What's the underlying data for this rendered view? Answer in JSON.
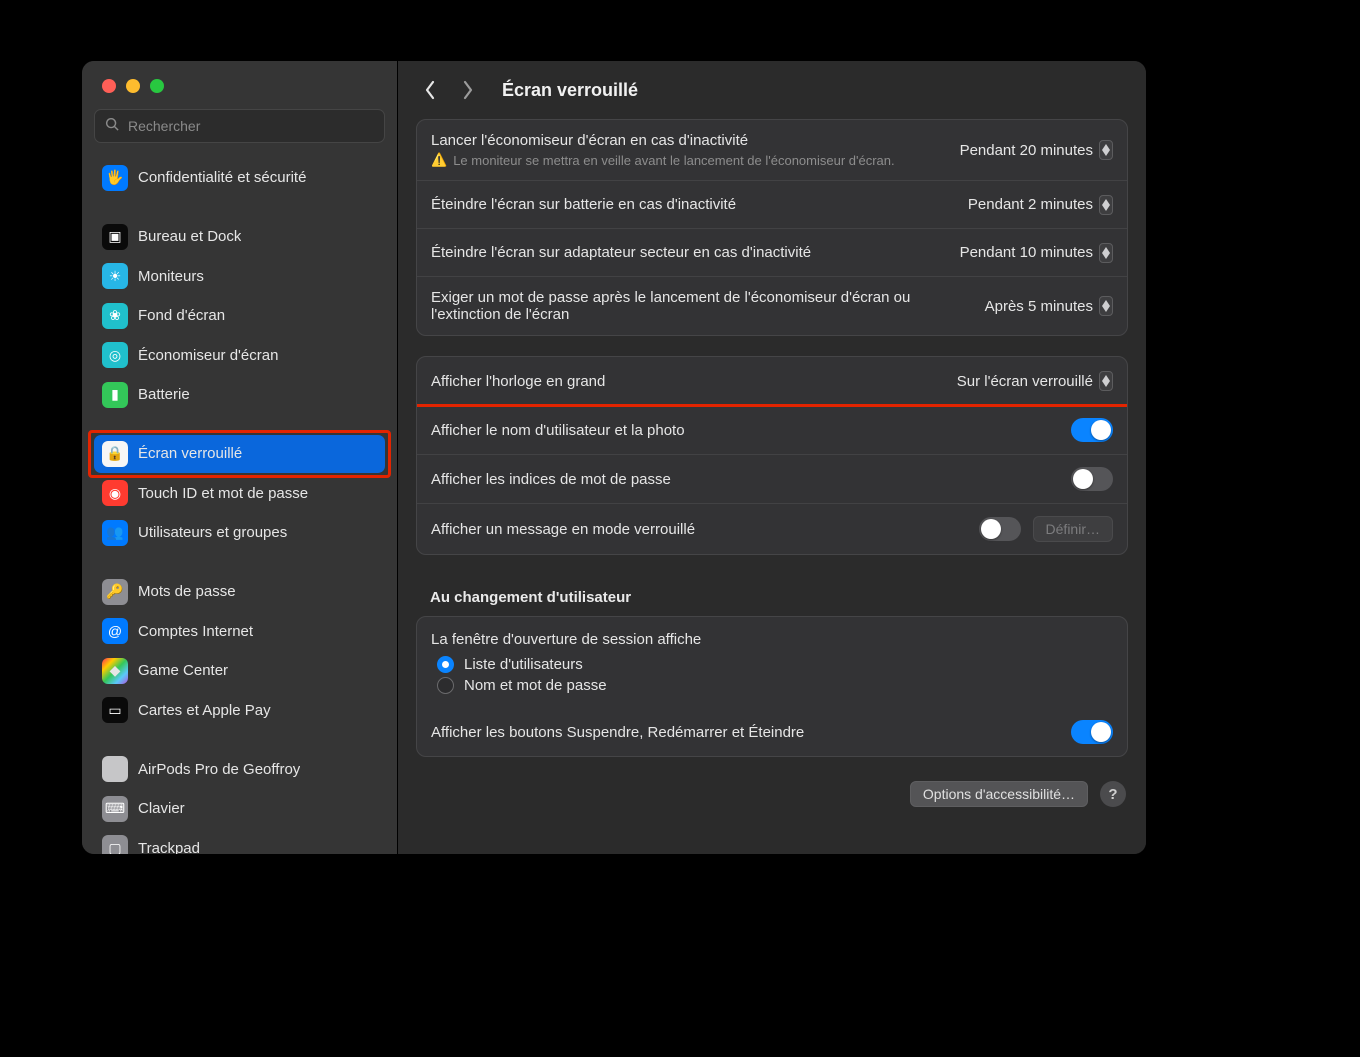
{
  "window": {
    "search_placeholder": "Rechercher",
    "page_title": "Écran verrouillé"
  },
  "sidebar": [
    {
      "id": "privacy",
      "label": "Confidentialité et sécurité",
      "icon": "🖐",
      "cls": "ic-blue"
    },
    {
      "gap": true
    },
    {
      "id": "desktop",
      "label": "Bureau et Dock",
      "icon": "▣",
      "cls": "ic-black"
    },
    {
      "id": "displays",
      "label": "Moniteurs",
      "icon": "☀",
      "cls": "ic-cyan"
    },
    {
      "id": "wallpaper",
      "label": "Fond d'écran",
      "icon": "❀",
      "cls": "ic-teal"
    },
    {
      "id": "ssaver",
      "label": "Économiseur d'écran",
      "icon": "◎",
      "cls": "ic-teal"
    },
    {
      "id": "battery",
      "label": "Batterie",
      "icon": "▮",
      "cls": "ic-green"
    },
    {
      "gap": true
    },
    {
      "id": "lockscreen",
      "label": "Écran verrouillé",
      "icon": "🔒",
      "cls": "ic-white",
      "selected": true,
      "highlight": true
    },
    {
      "id": "touchid",
      "label": "Touch ID et mot de passe",
      "icon": "◉",
      "cls": "ic-pink"
    },
    {
      "id": "users",
      "label": "Utilisateurs et groupes",
      "icon": "👥",
      "cls": "ic-blue"
    },
    {
      "gap": true
    },
    {
      "id": "passwords",
      "label": "Mots de passe",
      "icon": "🔑",
      "cls": "ic-gray"
    },
    {
      "id": "internet",
      "label": "Comptes Internet",
      "icon": "@",
      "cls": "ic-blue"
    },
    {
      "id": "gamecenter",
      "label": "Game Center",
      "icon": "◆",
      "cls": "ic-grad"
    },
    {
      "id": "wallet",
      "label": "Cartes et Apple Pay",
      "icon": "▭",
      "cls": "ic-black"
    },
    {
      "gap": true
    },
    {
      "id": "airpods",
      "label": "AirPods Pro de Geoffroy",
      "icon": " ",
      "cls": "ic-lgray"
    },
    {
      "id": "keyboard",
      "label": "Clavier",
      "icon": "⌨",
      "cls": "ic-gray"
    },
    {
      "id": "trackpad",
      "label": "Trackpad",
      "icon": "▢",
      "cls": "ic-gray"
    }
  ],
  "panels": {
    "screensaver_row": {
      "title": "Lancer l'économiseur d'écran en cas d'inactivité",
      "warning": "Le moniteur se mettra en veille avant le lancement de l'économiseur d'écran.",
      "value": "Pendant 20 minutes"
    },
    "display_batt": {
      "title": "Éteindre l'écran sur batterie en cas d'inactivité",
      "value": "Pendant 2 minutes"
    },
    "display_ac": {
      "title": "Éteindre l'écran sur adaptateur secteur en cas d'inactivité",
      "value": "Pendant 10 minutes"
    },
    "password_after": {
      "title": "Exiger un mot de passe après le lancement de l'économiseur d'écran ou l'extinction de l'écran",
      "value": "Après 5 minutes"
    },
    "big_clock": {
      "title": "Afficher l'horloge en grand",
      "value": "Sur l'écran verrouillé"
    },
    "show_user": {
      "title": "Afficher le nom d'utilisateur et la photo"
    },
    "show_hint": {
      "title": "Afficher les indices de mot de passe"
    },
    "show_message": {
      "title": "Afficher un message en mode verrouillé",
      "button": "Définir…"
    },
    "switching": {
      "heading": "Au changement d'utilisateur",
      "login_window_label": "La fenêtre d'ouverture de session affiche",
      "opt1": "Liste d'utilisateurs",
      "opt2": "Nom et mot de passe",
      "buttons_row": "Afficher les boutons Suspendre, Redémarrer et Éteindre"
    }
  },
  "footer": {
    "accessibility": "Options d'accessibilité…"
  }
}
